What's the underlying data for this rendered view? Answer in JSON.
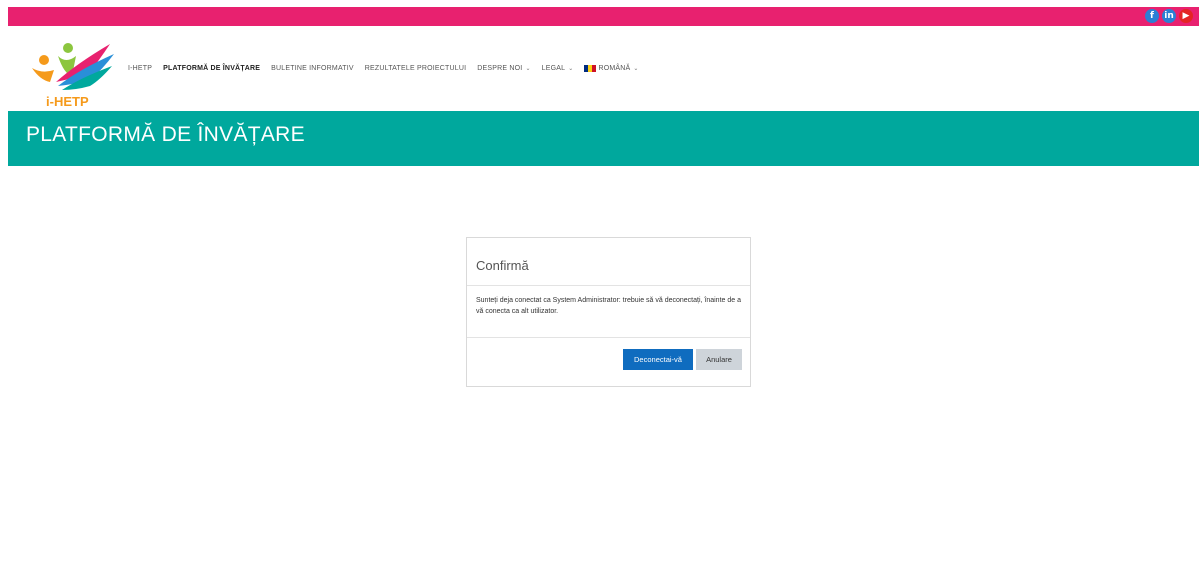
{
  "social": {
    "facebook": "f",
    "linkedin": "in",
    "youtube": "▶"
  },
  "logo": {
    "text": "i-HETP"
  },
  "nav": {
    "items": [
      {
        "label": "I-HETP"
      },
      {
        "label": "PLATFORMĂ DE ÎNVĂȚARE"
      },
      {
        "label": "BULETINE INFORMATIV"
      },
      {
        "label": "REZULTATELE PROIECTULUI"
      },
      {
        "label": "DESPRE NOI"
      },
      {
        "label": "LEGAL"
      },
      {
        "label": "ROMÂNĂ"
      }
    ],
    "caret": "⌄"
  },
  "banner": {
    "title": "PLATFORMĂ DE ÎNVĂȚARE"
  },
  "dialog": {
    "title": "Confirmă",
    "message": "Sunteți deja conectat ca System Administrator: trebuie să vă deconectați, înainte de a vă conecta ca alt utilizator.",
    "confirm_label": "Deconectai-vă",
    "cancel_label": "Anulare"
  },
  "colors": {
    "topbar": "#e8216f",
    "banner": "#00a89d",
    "primary_button": "#0f6cbf",
    "secondary_button": "#ced4da"
  }
}
